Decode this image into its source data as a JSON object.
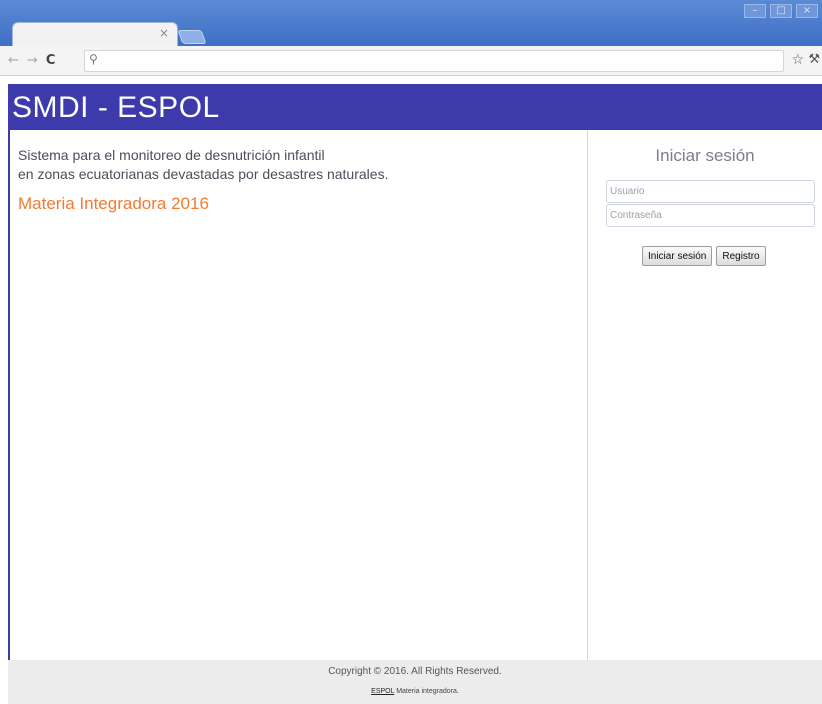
{
  "browser": {
    "tab_close": "×",
    "window_controls": [
      "–",
      "□",
      "×"
    ]
  },
  "toolbar": {
    "back_icon": "←",
    "forward_icon": "→",
    "reload_icon": "C",
    "search_icon": "⚲",
    "star_icon": "☆",
    "wrench_icon": "🔧"
  },
  "header": {
    "title": "SMDI - ESPOL"
  },
  "main": {
    "description_line1": "Sistema para el monitoreo de desnutrición infantil",
    "description_line2": "en zonas ecuatorianas devastadas por desastres naturales.",
    "subtitle": "Materia Integradora 2016"
  },
  "login": {
    "title": "Iniciar sesión",
    "username_placeholder": "Usuario",
    "password_placeholder": "Contraseña",
    "login_button": "Iniciar sesión",
    "register_button": "Registro"
  },
  "footer": {
    "copyright": "Copyright © 2016. All Rights Reserved.",
    "link": "ESPOL",
    "link_suffix": " Materia integradora."
  },
  "colors": {
    "header_bg": "#3d3aab",
    "accent": "#f47a30",
    "footer_bg": "#ececec"
  }
}
